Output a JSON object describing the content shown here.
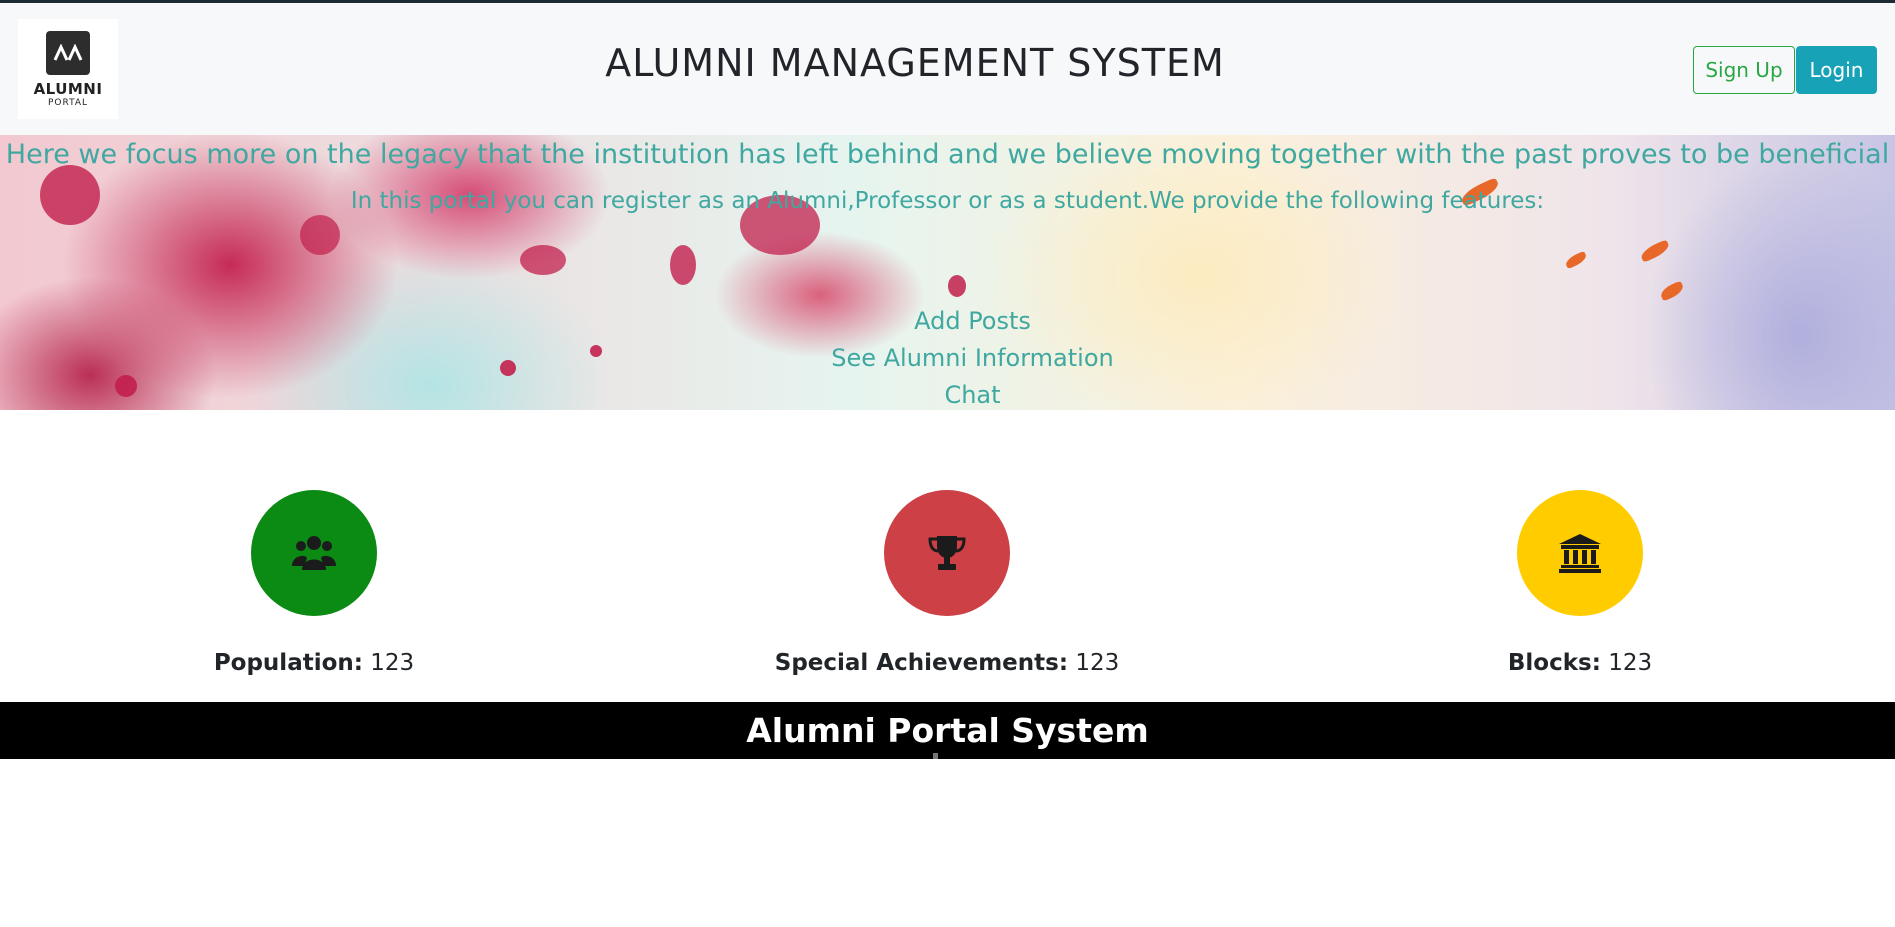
{
  "header": {
    "logo_word": "ALUMNI",
    "logo_sub": "PORTAL",
    "title": "ALUMNI MANAGEMENT SYSTEM",
    "signup_label": "Sign Up",
    "login_label": "Login"
  },
  "hero": {
    "line1": "Here we focus more on the legacy that the institution has left behind and we believe moving together with the past proves to be beneficial",
    "line2": "In this portal you can register as an Alumni,Professor or as a student.We provide the following features:",
    "features": [
      "Add Posts",
      "See Alumni Information",
      "Chat"
    ]
  },
  "stats": [
    {
      "label": "Population:",
      "value": "123",
      "icon": "users-icon",
      "color": "#0b8a14"
    },
    {
      "label": "Special Achievements:",
      "value": "123",
      "icon": "trophy-icon",
      "color": "#cc4046"
    },
    {
      "label": "Blocks:",
      "value": "123",
      "icon": "institution-icon",
      "color": "#ffcc00"
    }
  ],
  "footer": {
    "text": "Alumni Portal System"
  },
  "colors": {
    "accent_teal": "#3fa8a0",
    "signup": "#28a745",
    "login": "#17a2b8",
    "footer_bg": "#000000"
  }
}
